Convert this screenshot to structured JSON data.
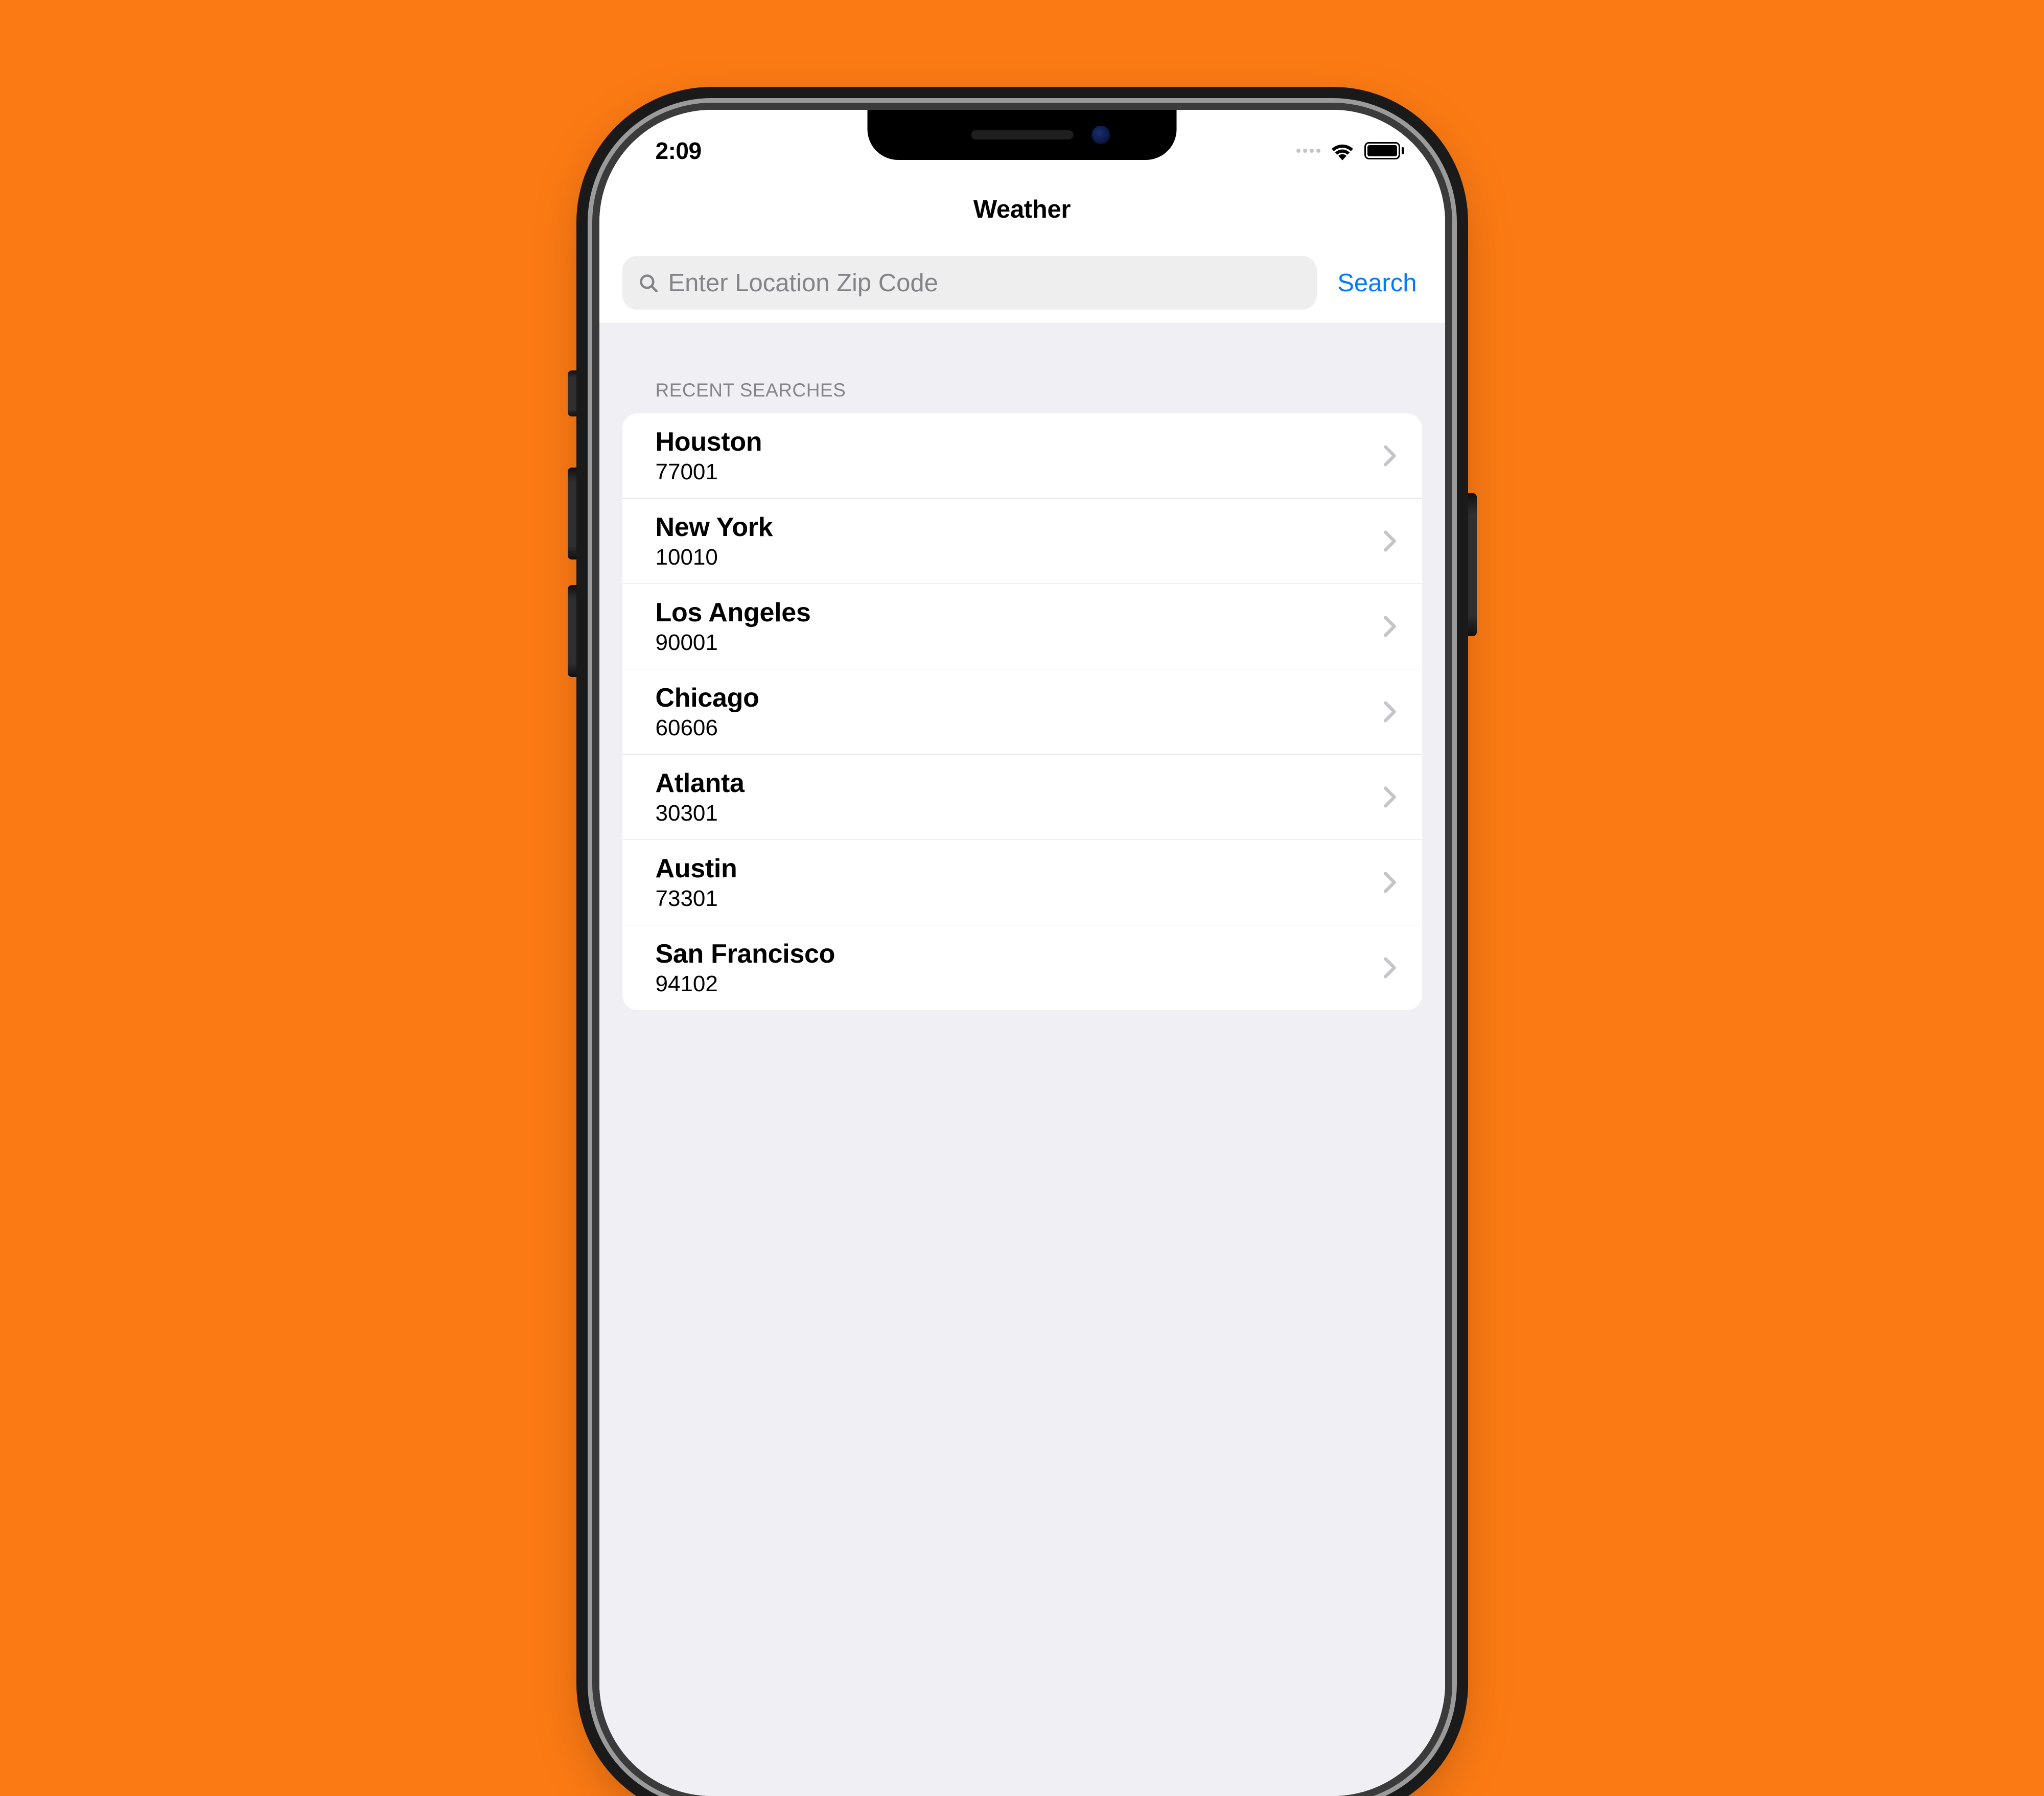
{
  "status": {
    "time": "2:09"
  },
  "nav": {
    "title": "Weather"
  },
  "search": {
    "placeholder": "Enter Location Zip Code",
    "button_label": "Search"
  },
  "section": {
    "header": "RECENT SEARCHES"
  },
  "recent": [
    {
      "city": "Houston",
      "zip": "77001"
    },
    {
      "city": "New York",
      "zip": "10010"
    },
    {
      "city": "Los Angeles",
      "zip": "90001"
    },
    {
      "city": "Chicago",
      "zip": "60606"
    },
    {
      "city": "Atlanta",
      "zip": "30301"
    },
    {
      "city": "Austin",
      "zip": "73301"
    },
    {
      "city": "San Francisco",
      "zip": "94102"
    }
  ]
}
